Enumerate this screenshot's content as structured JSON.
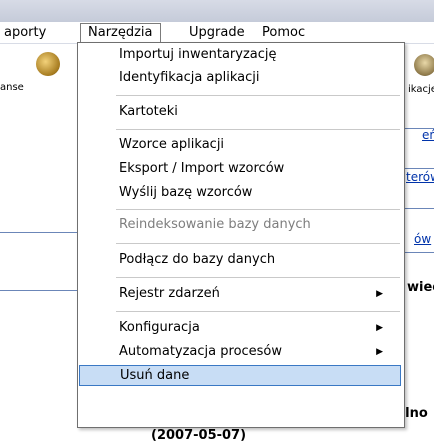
{
  "menubar": {
    "items": [
      {
        "label": "aporty"
      },
      {
        "label": "Narzędzia"
      },
      {
        "label": "Upgrade"
      },
      {
        "label": "Pomoc"
      }
    ]
  },
  "background": {
    "left_label": "anse",
    "right_label": "ikacje",
    "links": [
      "eń",
      "terów",
      "ów"
    ],
    "bold_text": "wieć",
    "article_title": "Artykuły nt. legalno",
    "article_date": "(2007-05-07)"
  },
  "dropdown": {
    "items": [
      {
        "label": "Importuj inwentaryzację",
        "disabled": false
      },
      {
        "label": "Identyfikacja aplikacji",
        "disabled": false
      },
      {
        "label": "Kartoteki",
        "disabled": false
      },
      {
        "label": "Wzorce aplikacji",
        "disabled": false
      },
      {
        "label": "Eksport / Import wzorców",
        "disabled": false
      },
      {
        "label": "Wyślij bazę wzorców",
        "disabled": false
      },
      {
        "label": "Reindeksowanie bazy danych",
        "disabled": true
      },
      {
        "label": "Podłącz do bazy danych",
        "disabled": false
      },
      {
        "label": "Rejestr zdarzeń",
        "submenu": true
      },
      {
        "label": "Konfiguracja",
        "submenu": true
      },
      {
        "label": "Automatyzacja procesów",
        "submenu": true
      },
      {
        "label": "Usuń dane",
        "highlighted": true
      }
    ],
    "submenu_arrow": "▶"
  },
  "colors": {
    "highlight_bg": "#c8ddf5",
    "highlight_border": "#3a78c4",
    "link": "#0033aa"
  }
}
